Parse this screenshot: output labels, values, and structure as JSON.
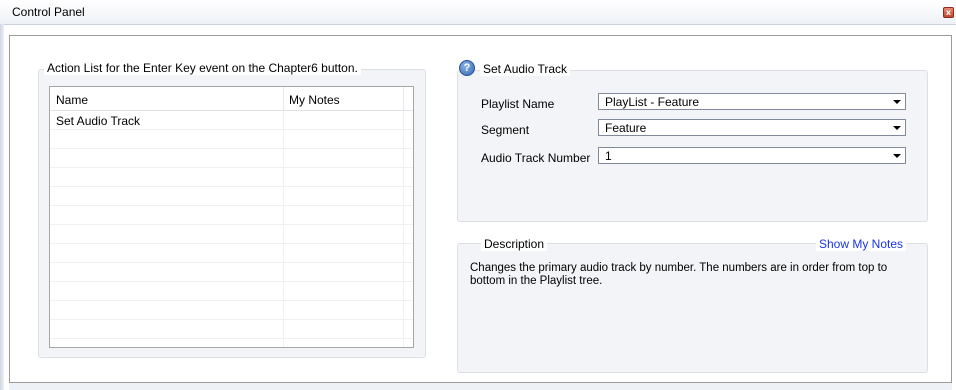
{
  "window": {
    "title": "Control Panel",
    "close_glyph": "x"
  },
  "action_list": {
    "group_title": "Action List for the Enter Key event on the Chapter6 button.",
    "columns": [
      "Name",
      "My Notes"
    ],
    "rows": [
      {
        "name": "Set Audio Track",
        "notes": ""
      }
    ]
  },
  "set_audio_track": {
    "title": "Set Audio Track",
    "help_glyph": "?",
    "fields": {
      "playlist": {
        "label": "Playlist Name",
        "value": "PlayList - Feature"
      },
      "segment": {
        "label": "Segment",
        "value": "Feature"
      },
      "audio_track": {
        "label": "Audio Track Number",
        "value": "1"
      }
    }
  },
  "description": {
    "title": "Description",
    "show_notes_link": "Show My Notes",
    "text": "Changes the primary audio track by number.  The numbers are in order from top to bottom in the Playlist tree."
  }
}
